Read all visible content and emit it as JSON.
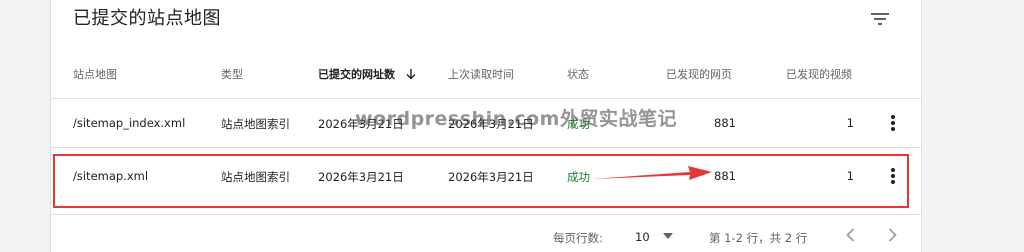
{
  "card": {
    "title": "已提交的站点地图",
    "filter_icon": "filter-icon"
  },
  "table": {
    "headers": {
      "sitemap": "站点地图",
      "type": "类型",
      "submitted": "已提交的网址数",
      "last_read": "上次读取时间",
      "status": "状态",
      "pages": "已发现的网页",
      "videos": "已发现的视频"
    },
    "sort_icon": "arrow-down-icon",
    "rows": [
      {
        "sitemap": "/sitemap_index.xml",
        "type": "站点地图索引",
        "submitted": "2026年3月21日",
        "last_read": "2026年3月21日",
        "status": "成功",
        "pages": "881",
        "videos": "1"
      },
      {
        "sitemap": "/sitemap.xml",
        "type": "站点地图索引",
        "submitted": "2026年3月21日",
        "last_read": "2026年3月21日",
        "status": "成功",
        "pages": "881",
        "videos": "1"
      }
    ],
    "row_menu_icon": "more-vert-icon"
  },
  "watermark": "wordpresshin.com外贸实战笔记",
  "annotation": {
    "highlight_color": "#e53935",
    "arrow_color": "#e53935"
  },
  "pagination": {
    "rows_per_page_label": "每页行数:",
    "rows_per_page_value": "10",
    "range_text": "第 1-2 行，共 2 行",
    "prev_icon": "chevron-left-icon",
    "next_icon": "chevron-right-icon"
  },
  "colors": {
    "success": "#188038",
    "text": "#202124",
    "muted": "#5f6368"
  }
}
